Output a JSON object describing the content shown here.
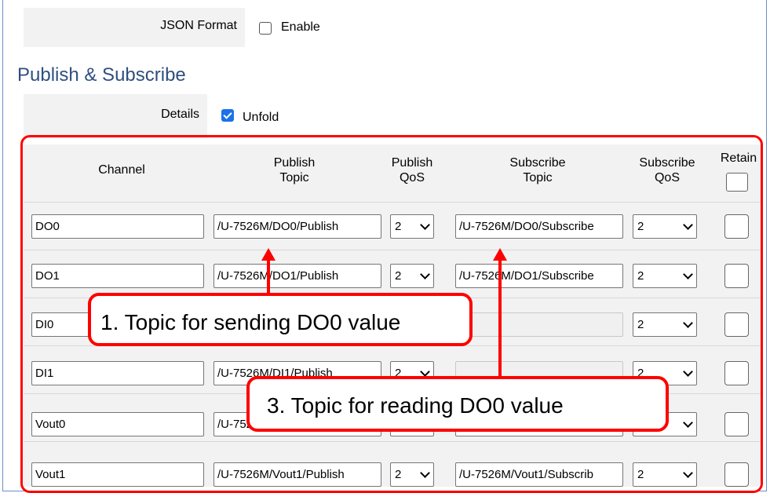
{
  "json_format": {
    "label": "JSON Format",
    "checkbox_label": "Enable",
    "checked": false
  },
  "section_title": "Publish & Subscribe",
  "details": {
    "label": "Details",
    "checkbox_label": "Unfold",
    "checked": true
  },
  "headers": {
    "channel": "Channel",
    "publish_topic_1": "Publish",
    "publish_topic_2": "Topic",
    "publish_qos_1": "Publish",
    "publish_qos_2": "QoS",
    "subscribe_topic_1": "Subscribe",
    "subscribe_topic_2": "Topic",
    "subscribe_qos_1": "Subscribe",
    "subscribe_qos_2": "QoS",
    "retain": "Retain"
  },
  "rows": [
    {
      "channel": "DO0",
      "publish_topic": "/U-7526M/DO0/Publish",
      "publish_qos": "2",
      "subscribe_topic": "/U-7526M/DO0/Subscribe",
      "subscribe_qos": "2"
    },
    {
      "channel": "DO1",
      "publish_topic": "/U-7526M/DO1/Publish",
      "publish_qos": "2",
      "subscribe_topic": "/U-7526M/DO1/Subscribe",
      "subscribe_qos": "2"
    },
    {
      "channel": "DI0",
      "publish_topic": "",
      "publish_qos": "",
      "subscribe_topic": "",
      "subscribe_qos": "2"
    },
    {
      "channel": "DI1",
      "publish_topic": "/U-7526M/DI1/Publish",
      "publish_qos": "2",
      "subscribe_topic": "",
      "subscribe_qos": "2"
    },
    {
      "channel": "Vout0",
      "publish_topic": "/U-7526M/Vout0/Publish",
      "publish_qos": "2",
      "subscribe_topic": "",
      "subscribe_qos": "2"
    },
    {
      "channel": "Vout1",
      "publish_topic": "/U-7526M/Vout1/Publish",
      "publish_qos": "2",
      "subscribe_topic": "/U-7526M/Vout1/Subscrib",
      "subscribe_qos": "2"
    }
  ],
  "callouts": {
    "one": "1. Topic for sending DO0 value",
    "three": "3. Topic for reading DO0 value"
  },
  "colors": {
    "annotation": "#ff0000",
    "section_title": "#2f4f7f",
    "checkbox_checked": "#1a73e8"
  }
}
